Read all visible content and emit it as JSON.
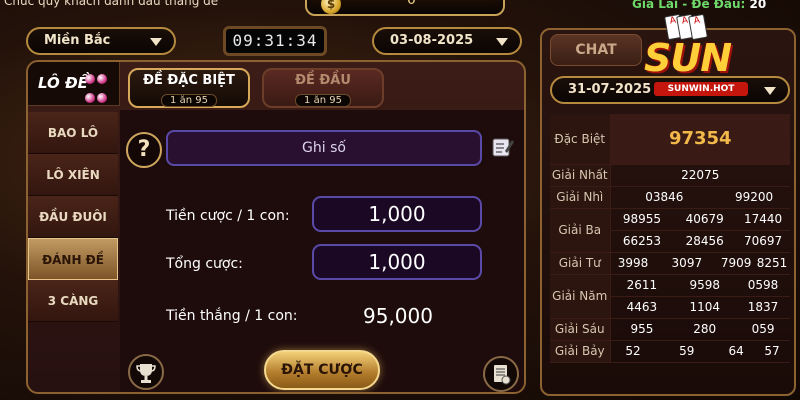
{
  "top": {
    "message": "Chúc quý khách đánh đầu thắng đề",
    "coin_value": "0",
    "profit_label": "Gia Lai - Đề Đầu:",
    "profit_value": "20"
  },
  "selectors": {
    "region": "Miền Bắc",
    "clock": "09:31:34",
    "date": "03-08-2025"
  },
  "logo": {
    "text": "LÔ ĐỀ"
  },
  "sidebar": {
    "items": [
      {
        "label": "BAO LÔ"
      },
      {
        "label": "LÔ XIÊN"
      },
      {
        "label": "ĐẦU ĐUÔI"
      },
      {
        "label": "ĐÁNH ĐỀ"
      },
      {
        "label": "3 CÀNG"
      }
    ],
    "active_index": 3
  },
  "tabs": [
    {
      "label": "ĐỀ ĐẶC BIỆT",
      "odds": "1 ăn 95"
    },
    {
      "label": "ĐỀ ĐẦU",
      "odds": "1 ăn 95"
    }
  ],
  "form": {
    "note_placeholder": "Ghi số",
    "bet_per_label": "Tiền cược / 1 con:",
    "bet_per_value": "1,000",
    "total_label": "Tổng cược:",
    "total_value": "1,000",
    "win_label": "Tiền thắng / 1 con:",
    "win_value": "95,000",
    "submit_label": "ĐẶT CƯỢC"
  },
  "right": {
    "chat_label": "CHAT",
    "result_date": "31-07-2025",
    "logo_text": "SUN",
    "logo_ribbon": "SUNWIN.HOT",
    "results": [
      {
        "label": "Đặc Biệt",
        "numbers": [
          "97354"
        ]
      },
      {
        "label": "Giải Nhất",
        "numbers": [
          "22075"
        ]
      },
      {
        "label": "Giải Nhì",
        "numbers": [
          "03846",
          "99200"
        ]
      },
      {
        "label": "Giải Ba",
        "numbers": [
          "98955",
          "40679",
          "17440",
          "66253",
          "28456",
          "70697"
        ]
      },
      {
        "label": "Giải Tư",
        "numbers": [
          "3998",
          "3097",
          "7909",
          "8251"
        ]
      },
      {
        "label": "Giải Năm",
        "numbers": [
          "2611",
          "9598",
          "0598",
          "4463",
          "1104",
          "1837"
        ]
      },
      {
        "label": "Giải Sáu",
        "numbers": [
          "955",
          "280",
          "059"
        ]
      },
      {
        "label": "Giải Bảy",
        "numbers": [
          "52",
          "59",
          "64",
          "57"
        ]
      }
    ]
  },
  "colors": {
    "accent_gold": "#d6a85a",
    "special_prize": "#f3b84a",
    "profit_green": "#6fd86a"
  }
}
